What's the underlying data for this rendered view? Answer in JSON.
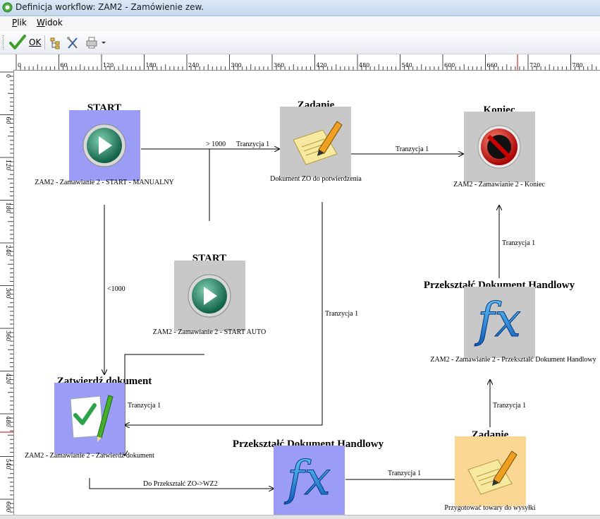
{
  "window": {
    "title": "Definicja workflow: ZAM2 - Zamówienie zew."
  },
  "menu": {
    "items": [
      {
        "label": "Plik",
        "ul": "P",
        "rest": "lik"
      },
      {
        "label": "Widok",
        "ul": "W",
        "rest": "idok"
      }
    ]
  },
  "toolbar": {
    "ok_label": "OK"
  },
  "ruler": {
    "h_ticks": [
      "0",
      "60",
      "120",
      "180",
      "240",
      "300",
      "360",
      "420",
      "480",
      "540",
      "600",
      "660",
      "720",
      "780"
    ],
    "v_ticks": [
      "0",
      "60",
      "120",
      "180",
      "240",
      "300",
      "360",
      "420",
      "480",
      "540",
      "600"
    ]
  },
  "nodes": {
    "start_manual": {
      "title": "START",
      "caption": "ZAM2 - Zamawianie 2 - START - MANUALNY"
    },
    "zadanie_top": {
      "title": "Zadanie",
      "caption": "Dokument ZO do potwierdzenia"
    },
    "koniec": {
      "title": "Koniec",
      "caption": "ZAM2 - Zamawianie 2 - Koniec"
    },
    "start_auto": {
      "title": "START",
      "caption": "ZAM2 - Zamawianie 2 - START AUTO"
    },
    "przeksztalc_right": {
      "title": "Przekształć Dokument Handlowy",
      "caption": "ZAM2 - Zamawianie 2 - Przekształć Dokument Handlowy"
    },
    "zatwierdz": {
      "title": "Zatwierdź dokument",
      "caption": "ZAM2 - Zamawianie 2 - Zatwierdź dokument"
    },
    "przeksztalc_bottom": {
      "title": "Przekształć Dokument Handlowy",
      "caption": ""
    },
    "zadanie_bottom": {
      "title": "Zadanie",
      "caption": "Przygotować towary do wysyłki"
    }
  },
  "edges": {
    "gt1000": "> 1000",
    "t_start_zad": "Tranzycja 1",
    "t_zad_kon": "Tranzycja 1",
    "lt1000": "<1000",
    "t_zad_zatw": "Tranzycja 1",
    "t_auto_zatw": "Tranzycja 1",
    "t_prz_kon": "Tranzycja 1",
    "t_zadb_prz": "Tranzycja 1",
    "do_przeksztalc": "Do Przekształć ZO->WZ2",
    "t_przb_zadb": "Tranzycja 1"
  },
  "icons": {
    "start": "play-icon",
    "task": "note-pencil-icon",
    "end": "stop-icon",
    "transform": "fx-icon",
    "approve": "check-document-icon"
  },
  "colors": {
    "start_bg": "#9a9cf5",
    "task_bg": "#c8c8c8",
    "task_active_bg": "#fbd796",
    "transform_bg": "#9a9cf5",
    "transform_inactive_bg": "#c8c8c8",
    "approve_bg": "#9a9cf5",
    "end_bg": "#c8c8c8"
  }
}
